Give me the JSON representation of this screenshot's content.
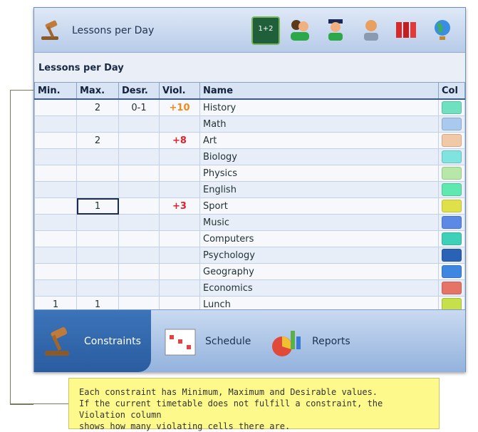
{
  "header": {
    "title": "Lessons per Day",
    "icons": [
      "gavel-icon",
      "math-board-icon",
      "teachers-icon",
      "graduate-icon",
      "teacher-icon",
      "books-icon",
      "globe-icon"
    ]
  },
  "subheader": {
    "title": "Lessons per Day"
  },
  "table": {
    "columns": [
      "Min.",
      "Max.",
      "Desr.",
      "Viol.",
      "Name",
      "Col"
    ],
    "rows": [
      {
        "min": "",
        "max": "2",
        "desr": "0-1",
        "viol": "+10",
        "name": "History",
        "color": "#6fe0c0"
      },
      {
        "min": "",
        "max": "",
        "desr": "",
        "viol": "",
        "name": "Math",
        "color": "#a9c9ef"
      },
      {
        "min": "",
        "max": "2",
        "desr": "",
        "viol": "+8",
        "name": "Art",
        "color": "#f2c9a6"
      },
      {
        "min": "",
        "max": "",
        "desr": "",
        "viol": "",
        "name": "Biology",
        "color": "#7fe3de"
      },
      {
        "min": "",
        "max": "",
        "desr": "",
        "viol": "",
        "name": "Physics",
        "color": "#b8e8a8"
      },
      {
        "min": "",
        "max": "",
        "desr": "",
        "viol": "",
        "name": "English",
        "color": "#5fe8b0"
      },
      {
        "min": "",
        "max": "1",
        "desr": "",
        "viol": "+3",
        "name": "Sport",
        "color": "#e0e04a"
      },
      {
        "min": "",
        "max": "",
        "desr": "",
        "viol": "",
        "name": "Music",
        "color": "#5c88e6"
      },
      {
        "min": "",
        "max": "",
        "desr": "",
        "viol": "",
        "name": "Computers",
        "color": "#3fd0b8"
      },
      {
        "min": "",
        "max": "",
        "desr": "",
        "viol": "",
        "name": "Psychology",
        "color": "#2a62b5"
      },
      {
        "min": "",
        "max": "",
        "desr": "",
        "viol": "",
        "name": "Geography",
        "color": "#3f86e0"
      },
      {
        "min": "",
        "max": "",
        "desr": "",
        "viol": "",
        "name": "Economics",
        "color": "#e57366"
      },
      {
        "min": "1",
        "max": "1",
        "desr": "",
        "viol": "",
        "name": "Lunch",
        "color": "#c5e04a"
      }
    ]
  },
  "footer": {
    "tabs": [
      {
        "label": "Constraints",
        "active": true
      },
      {
        "label": "Schedule",
        "active": false
      },
      {
        "label": "Reports",
        "active": false
      }
    ]
  },
  "callout": [
    "Each constraint has Minimum, Maximum and Desirable values.",
    "If the current timetable does not fulfill a constraint, the Violation column",
    "shows how many violating cells there are."
  ]
}
